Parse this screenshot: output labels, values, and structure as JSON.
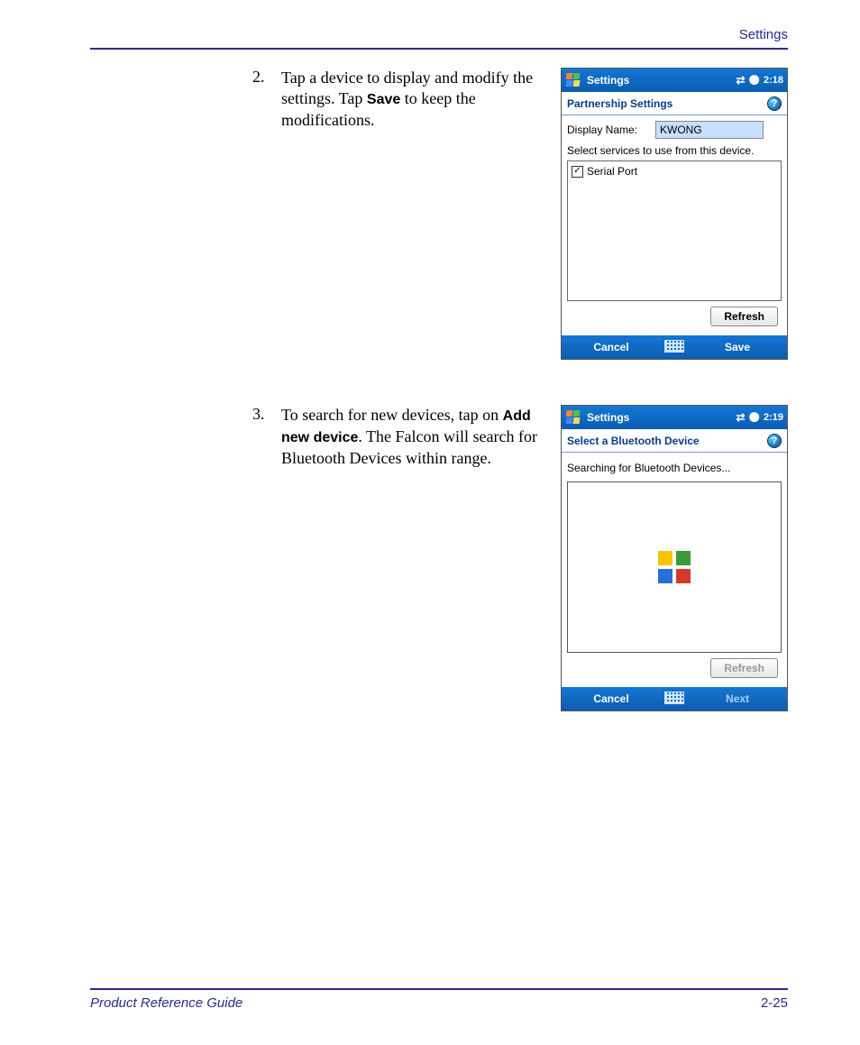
{
  "header": {
    "section": "Settings"
  },
  "steps": [
    {
      "num": "2.",
      "parts": [
        "Tap a device to display and mod­ify the settings. Tap ",
        "Save",
        " to keep the modifications."
      ]
    },
    {
      "num": "3.",
      "parts": [
        "To search for new devices, tap on ",
        "Add new device",
        ". The Falcon will search for Bluetooth Devices within range."
      ]
    }
  ],
  "screen1": {
    "topbar_title": "Settings",
    "time": "2:18",
    "subheader": "Partnership Settings",
    "display_name_label": "Display Name:",
    "display_name_value": "KWONG",
    "instruction": "Select services to use from this device.",
    "service_item": "Serial Port",
    "refresh": "Refresh",
    "cancel": "Cancel",
    "save": "Save"
  },
  "screen2": {
    "topbar_title": "Settings",
    "time": "2:19",
    "subheader": "Select a Bluetooth Device",
    "status": "Searching for Bluetooth Devices...",
    "refresh": "Refresh",
    "cancel": "Cancel",
    "next": "Next"
  },
  "footer": {
    "guide": "Product Reference Guide",
    "page": "2-25"
  }
}
